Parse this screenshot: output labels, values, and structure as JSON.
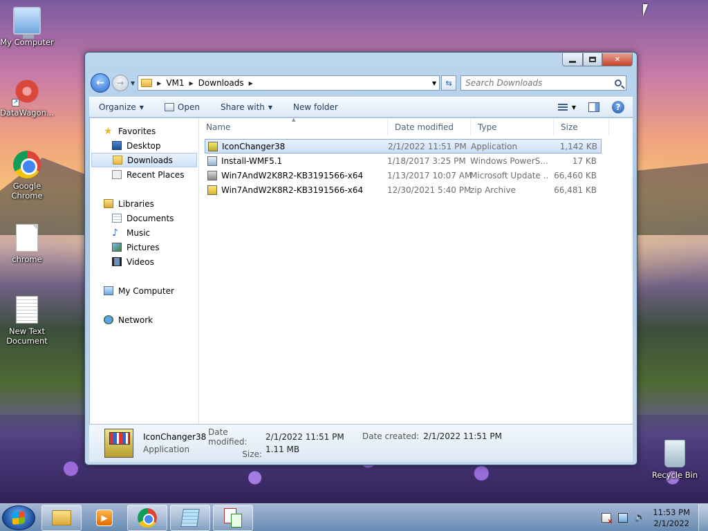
{
  "desktop": {
    "icons": [
      {
        "label": "My Computer",
        "icon": "computer-icon"
      },
      {
        "label": "DataWagon...",
        "icon": "datawagon-icon"
      },
      {
        "label": "Google Chrome",
        "icon": "chrome-icon"
      },
      {
        "label": "chrome",
        "icon": "document-icon"
      },
      {
        "label": "New Text Document",
        "icon": "text-document-icon"
      },
      {
        "label": "Recycle Bin",
        "icon": "recycle-bin-icon"
      }
    ]
  },
  "window": {
    "breadcrumb": [
      "VM1",
      "Downloads"
    ],
    "search_placeholder": "Search Downloads",
    "toolbar": {
      "organize": "Organize",
      "open": "Open",
      "share_with": "Share with",
      "new_folder": "New folder"
    },
    "nav": {
      "favorites": "Favorites",
      "desktop": "Desktop",
      "downloads": "Downloads",
      "recent_places": "Recent Places",
      "libraries": "Libraries",
      "documents": "Documents",
      "music": "Music",
      "pictures": "Pictures",
      "videos": "Videos",
      "my_computer": "My Computer",
      "network": "Network"
    },
    "columns": {
      "name": "Name",
      "date_modified": "Date modified",
      "type": "Type",
      "size": "Size"
    },
    "files": [
      {
        "name": "IconChanger38",
        "date": "2/1/2022 11:51 PM",
        "type": "Application",
        "size": "1,142 KB",
        "icon": "application-icon"
      },
      {
        "name": "Install-WMF5.1",
        "date": "1/18/2017 3:25 PM",
        "type": "Windows PowerS...",
        "size": "17 KB",
        "icon": "powershell-script-icon"
      },
      {
        "name": "Win7AndW2K8R2-KB3191566-x64",
        "date": "1/13/2017 10:07 AM",
        "type": "Microsoft Update ...",
        "size": "66,460 KB",
        "icon": "update-package-icon"
      },
      {
        "name": "Win7AndW2K8R2-KB3191566-x64",
        "date": "12/30/2021 5:40 PM",
        "type": "zip Archive",
        "size": "66,481 KB",
        "icon": "zip-archive-icon"
      }
    ],
    "details": {
      "name": "IconChanger38",
      "type": "Application",
      "date_modified_label": "Date modified:",
      "date_modified": "2/1/2022 11:51 PM",
      "size_label": "Size:",
      "size": "1.11 MB",
      "date_created_label": "Date created:",
      "date_created": "2/1/2022 11:51 PM"
    }
  },
  "taskbar": {
    "time": "11:53 PM",
    "date": "2/1/2022"
  }
}
